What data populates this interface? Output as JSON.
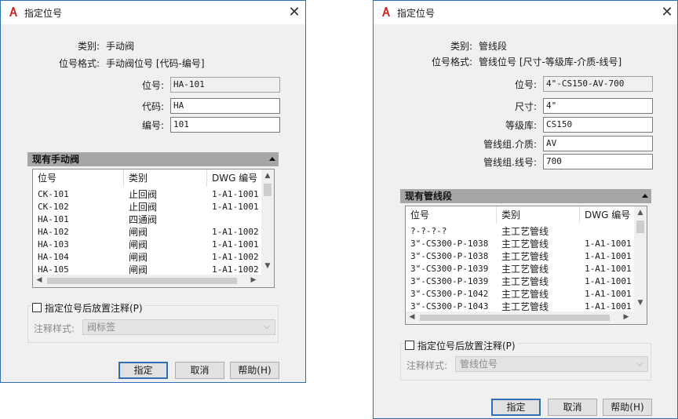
{
  "dialogs": [
    {
      "title": "指定位号",
      "category_label": "类别:",
      "category_value": "手动阀",
      "format_label": "位号格式:",
      "format_value": "手动阀位号 [代码-编号]",
      "fields": [
        {
          "label": "位号:",
          "value": "HA-101",
          "readonly": true
        },
        {
          "label": "代码:",
          "value": "HA",
          "readonly": false
        },
        {
          "label": "编号:",
          "value": "101",
          "readonly": false
        }
      ],
      "section_title": "现有手动阀",
      "columns": [
        "位号",
        "类别",
        "DWG 编号"
      ],
      "rows": [
        [
          "CK-101",
          "止回阀",
          "1-A1-1001"
        ],
        [
          "CK-102",
          "止回阀",
          "1-A1-1001"
        ],
        [
          "HA-101",
          "四通阀",
          ""
        ],
        [
          "HA-102",
          "闸阀",
          "1-A1-1002"
        ],
        [
          "HA-103",
          "闸阀",
          "1-A1-1001"
        ],
        [
          "HA-104",
          "闸阀",
          "1-A1-1002"
        ],
        [
          "HA-105",
          "闸阀",
          "1-A1-1002"
        ]
      ],
      "place_annotation_label": "指定位号后放置注释(P)",
      "place_annotation_checked": false,
      "annotation_style_label": "注释样式:",
      "annotation_style_value": "阀标签",
      "buttons": {
        "ok": "指定",
        "cancel": "取消",
        "help": "帮助(H)"
      }
    },
    {
      "title": "指定位号",
      "category_label": "类别:",
      "category_value": "管线段",
      "format_label": "位号格式:",
      "format_value": "管线位号 [尺寸-等级库-介质-线号]",
      "fields": [
        {
          "label": "位号:",
          "value": "4\"-CS150-AV-700",
          "readonly": true
        },
        {
          "label": "尺寸:",
          "value": "4\"",
          "readonly": false
        },
        {
          "label": "等级库:",
          "value": "CS150",
          "readonly": false
        },
        {
          "label": "管线组.介质:",
          "value": "AV",
          "readonly": false
        },
        {
          "label": "管线组.线号:",
          "value": "700",
          "readonly": false
        }
      ],
      "section_title": "现有管线段",
      "columns": [
        "位号",
        "类别",
        "DWG 编号"
      ],
      "rows": [
        [
          "?-?-?-?",
          "主工艺管线",
          ""
        ],
        [
          "3\"-CS300-P-1038",
          "主工艺管线",
          "1-A1-1001"
        ],
        [
          "3\"-CS300-P-1038",
          "主工艺管线",
          "1-A1-1001"
        ],
        [
          "3\"-CS300-P-1039",
          "主工艺管线",
          "1-A1-1001"
        ],
        [
          "3\"-CS300-P-1039",
          "主工艺管线",
          "1-A1-1001"
        ],
        [
          "3\"-CS300-P-1042",
          "主工艺管线",
          "1-A1-1001"
        ],
        [
          "3\"-CS300-P-1043",
          "主工艺管线",
          "1-A1-1001"
        ]
      ],
      "place_annotation_label": "指定位号后放置注释(P)",
      "place_annotation_checked": false,
      "annotation_style_label": "注释样式:",
      "annotation_style_value": "管线位号",
      "buttons": {
        "ok": "指定",
        "cancel": "取消",
        "help": "帮助(H)"
      }
    }
  ],
  "colors": {
    "accent": "#2f6fb7",
    "app_icon": "#d0211c",
    "section_bar": "#a6a6a6"
  },
  "icons": [
    "autocad-app-icon",
    "close-icon",
    "collapse-triangle-icon",
    "scroll-up-icon",
    "scroll-down-icon",
    "scroll-left-icon",
    "scroll-right-icon",
    "dropdown-chevron-icon"
  ]
}
